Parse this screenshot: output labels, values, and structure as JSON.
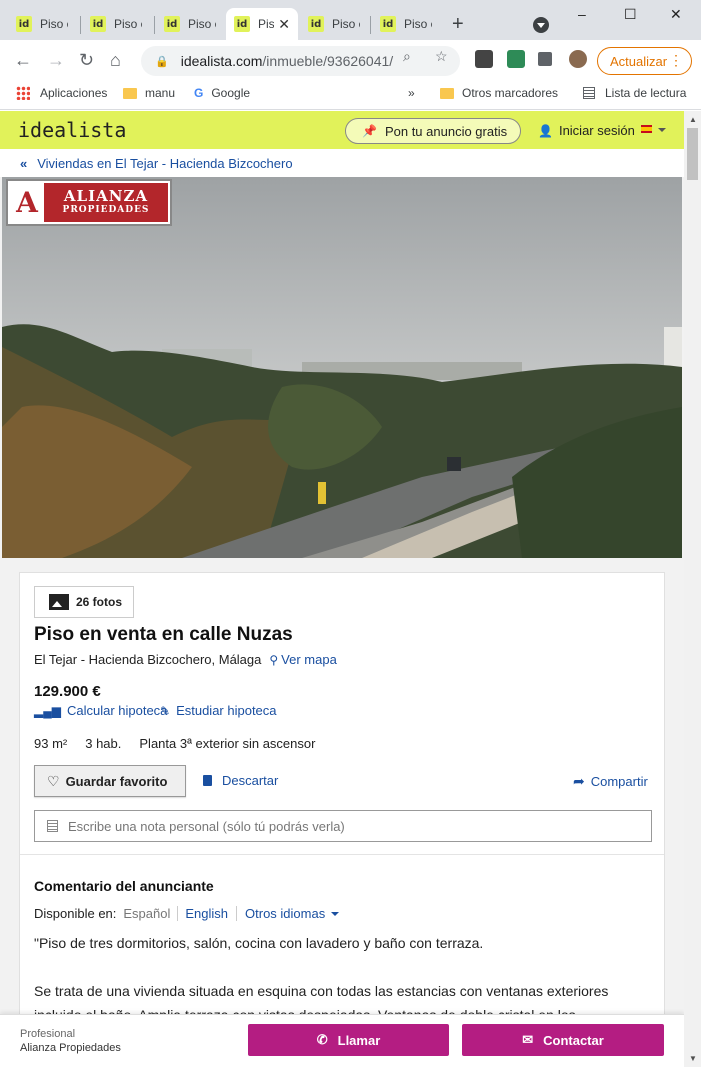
{
  "browser": {
    "tabs": [
      {
        "favicon": "id",
        "title": "Piso e"
      },
      {
        "favicon": "id",
        "title": "Piso e"
      },
      {
        "favicon": "id",
        "title": "Piso e"
      },
      {
        "favicon": "id",
        "title": "Pis"
      },
      {
        "favicon": "id",
        "title": "Piso e"
      },
      {
        "favicon": "id",
        "title": "Piso e"
      }
    ],
    "new_tab": "+",
    "window_controls": {
      "minimize": "–",
      "maximize": "☐",
      "close": "✕"
    },
    "url": {
      "host": "idealista.com",
      "path": "/inmueble/93626041/"
    },
    "update_label": "Actualizar",
    "bookmarks": {
      "apps": "Aplicaciones",
      "manu": "manu",
      "google": "Google",
      "more": "»",
      "others": "Otros marcadores",
      "reading_list": "Lista de lectura"
    }
  },
  "site": {
    "logo": "idealista",
    "post_ad": "Pon tu anuncio gratis",
    "login": "Iniciar sesión",
    "brand_color": "#e1f25a",
    "accent_color": "#b41d82"
  },
  "breadcrumb": {
    "label": "Viviendas en El Tejar - Hacienda Bizcochero"
  },
  "agency_logo": {
    "line1": "ALIANZA",
    "line2": "PROPIEDADES"
  },
  "listing": {
    "photos_count": "26 fotos",
    "title": "Piso en venta en calle Nuzas",
    "location": "El Tejar - Hacienda Bizcochero, Málaga",
    "map_link": "Ver mapa",
    "price": "129.900 €",
    "calc_mortgage": "Calcular hipoteca",
    "study_mortgage": "Estudiar hipoteca",
    "features": [
      "93 m²",
      "3 hab.",
      "Planta 3ª exterior sin ascensor"
    ],
    "save_favorite": "Guardar favorito",
    "discard": "Descartar",
    "share": "Compartir",
    "note_placeholder": "Escribe una nota personal (sólo tú podrás verla)"
  },
  "comment": {
    "title": "Comentario del anunciante",
    "available_in": "Disponible en:",
    "lang_current": "Español",
    "lang_english": "English",
    "lang_other": "Otros idiomas",
    "paragraphs": [
      "\"Piso de tres dormitorios, salón, cocina con lavadero y baño con terraza.",
      "Se trata de una vivienda situada en esquina con todas las estancias con ventanas exteriores incluido el baño. Amplia terraza con vistas despejadas. Ventanas de doble cristal en los"
    ]
  },
  "contact_bar": {
    "type": "Profesional",
    "agency": "Alianza Propiedades",
    "call": "Llamar",
    "contact": "Contactar"
  }
}
